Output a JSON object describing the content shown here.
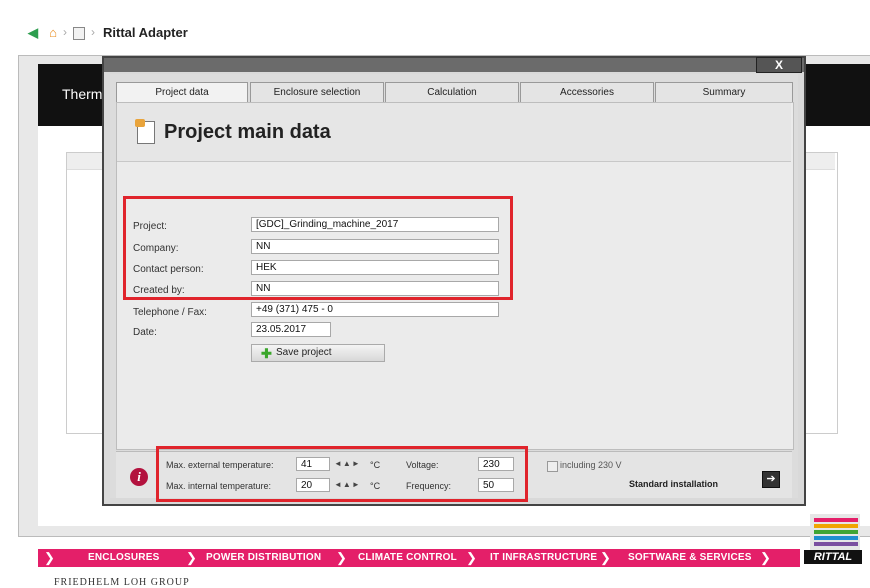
{
  "breadcrumb": {
    "title": "Rittal Adapter"
  },
  "background_app": {
    "title_partial": "Therm"
  },
  "dialog": {
    "close_label": "X",
    "tabs": [
      {
        "label": "Project data"
      },
      {
        "label": "Enclosure selection"
      },
      {
        "label": "Calculation"
      },
      {
        "label": "Accessories"
      },
      {
        "label": "Summary"
      }
    ],
    "page_title": "Project main data",
    "form": {
      "project_label": "Project:",
      "project_value": "[GDC]_Grinding_machine_2017",
      "company_label": "Company:",
      "company_value": "NN",
      "contact_label": "Contact person:",
      "contact_value": "HEK",
      "created_label": "Created by:",
      "created_value": "NN",
      "phone_label": "Telephone / Fax:",
      "phone_value": "+49 (371) 475 - 0",
      "date_label": "Date:",
      "date_value": "23.05.2017",
      "save_label": "Save project"
    },
    "bottom": {
      "ext_temp_label": "Max. external temperature:",
      "ext_temp_value": "41",
      "int_temp_label": "Max. internal temperature:",
      "int_temp_value": "20",
      "unit_c": "°C",
      "voltage_label": "Voltage:",
      "voltage_value": "230",
      "frequency_label": "Frequency:",
      "frequency_value": "50",
      "including_label": "including 230 V",
      "standard_label": "Standard installation"
    }
  },
  "nav": {
    "items": [
      {
        "label": "ENCLOSURES"
      },
      {
        "label": "POWER DISTRIBUTION"
      },
      {
        "label": "CLIMATE CONTROL"
      },
      {
        "label": "IT INFRASTRUCTURE"
      },
      {
        "label": "SOFTWARE & SERVICES"
      }
    ],
    "footer": "FRIEDHELM LOH GROUP",
    "logo_text": "RITTAL"
  },
  "colors": {
    "accent_pink": "#e41f69",
    "highlight_red": "#e0242c",
    "info_icon": "#b3123e"
  }
}
